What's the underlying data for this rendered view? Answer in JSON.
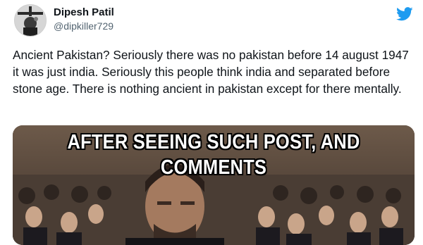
{
  "tweet": {
    "author": {
      "display_name": "Dipesh Patil",
      "handle": "@dipkiller729",
      "avatar_icon": "avatar-image"
    },
    "brand_icon": "twitter-bird-icon",
    "brand_color": "#1d9bf0",
    "text": "Ancient Pakistan? Seriously there was no pakistan before 14 august 1947 it was just india. Seriously this people think india and separated before stone age. There is nothing ancient in pakistan except for there mentally.",
    "media": {
      "caption": "AFTER SEEING SUCH POST, AND COMMENTS"
    }
  }
}
